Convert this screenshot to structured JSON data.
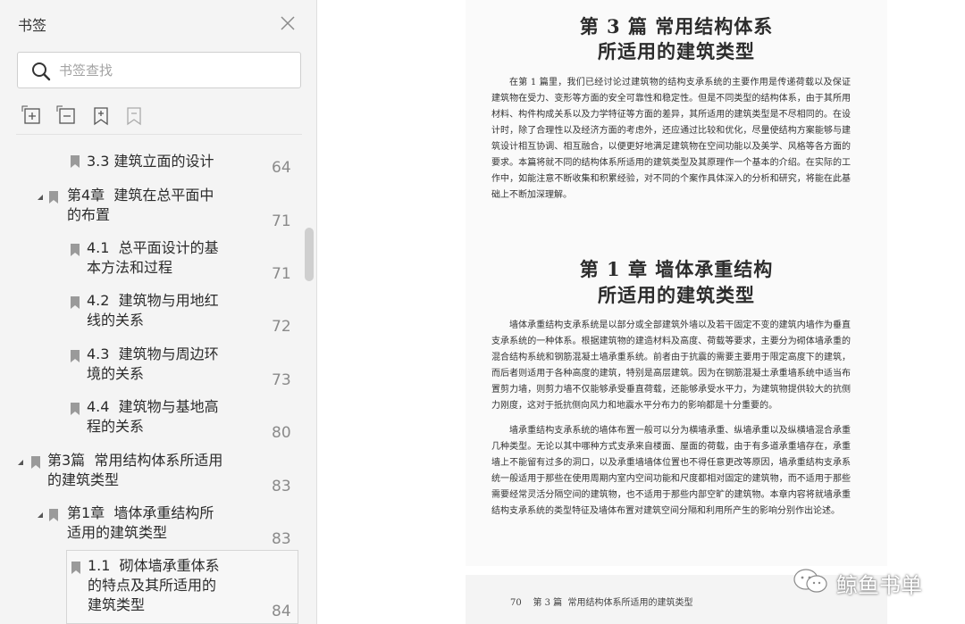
{
  "sidebar": {
    "title": "书签",
    "search_placeholder": "书签查找",
    "bookmarks": [
      {
        "label": "3.3  建筑立面的设计",
        "page": "64"
      },
      {
        "label": "第4章  建筑在总平面中\n的布置",
        "page": "71"
      },
      {
        "label": "4.1  总平面设计的基\n本方法和过程",
        "page": "71"
      },
      {
        "label": "4.2  建筑物与用地红\n线的关系",
        "page": "72"
      },
      {
        "label": "4.3  建筑物与周边环\n境的关系",
        "page": "73"
      },
      {
        "label": "4.4  建筑物与基地高\n程的关系",
        "page": "80"
      },
      {
        "label": "第3篇  常用结构体系所适用\n的建筑类型",
        "page": "83"
      },
      {
        "label": "第1章  墙体承重结构所\n适用的建筑类型",
        "page": "83"
      },
      {
        "label": "1.1  砌体墙承重体系\n的特点及其所适用的\n建筑类型",
        "page": "84"
      }
    ]
  },
  "document": {
    "part_title_1": "第 3 篇   常用结构体系",
    "part_title_2": "所适用的建筑类型",
    "intro": "在第 1 篇里，我们已经讨论过建筑物的结构支承系统的主要作用是传递荷载以及保证建筑物在受力、变形等方面的安全可靠性和稳定性。但是不同类型的结构体系，由于其所用材料、构件构成关系以及力学特征等方面的差异，其所适用的建筑类型是不尽相同的。在设计时，除了合理性以及经济方面的考虑外，还应通过比较和优化，尽量使结构方案能够与建筑设计相互协调、相互融合，以便更好地满足建筑物在空间功能以及美学、风格等各方面的要求。本篇将就不同的结构体系所适用的建筑类型及其原理作一个基本的介绍。在实际的工作中，如能注意不断收集和积累经验，对不同的个案作具体深入的分析和研究，将能在此基础上不断加深理解。",
    "chapter_title_1": "第 1 章   墙体承重结构",
    "chapter_title_2": "所适用的建筑类型",
    "para1": "墙体承重结构支承系统是以部分或全部建筑外墙以及若干固定不变的建筑内墙作为垂直支承系统的一种体系。根据建筑物的建造材料及高度、荷载等要求，主要分为砌体墙承重的混合结构系统和钢筋混凝土墙承重系统。前者由于抗震的需要主要用于限定高度下的建筑，而后者则适用于各种高度的建筑，特别是高层建筑。因为在钢筋混凝土承重墙系统中适当布置剪力墙，则剪力墙不仅能够承受垂直荷载，还能够承受水平力，为建筑物提供较大的抗侧力刚度，这对于抵抗侧向风力和地震水平分布力的影响都是十分重要的。",
    "para2": "墙承重结构支承系统的墙体布置一般可以分为横墙承重、纵墙承重以及纵横墙混合承重几种类型。无论以其中哪种方式支承来自楼面、屋面的荷载，由于有多道承重墙存在，承重墙上不能留有过多的洞口，以及承重墙墙体位置也不得任意更改等原因，墙承重结构支承系统一般适用于那些在使用周期内室内空间功能和尺度都相对固定的建筑物，而不适用于那些需要经常灵活分隔空间的建筑物，也不适用于那些内部空旷的建筑物。本章内容将就墙承重结构支承系统的类型特征及墙体布置对建筑空间分隔和利用所产生的影响分别作出论述。",
    "footer": "70    第 3 篇  常用结构体系所适用的建筑类型"
  },
  "watermark": {
    "text": "鲸鱼书单"
  },
  "icons": {
    "close": "close-icon",
    "search": "search-icon",
    "expand_all": "expand-all-icon",
    "collapse_all": "collapse-all-icon",
    "add_bookmark": "add-bookmark-icon",
    "remove_bookmark": "remove-bookmark-icon",
    "bookmark": "bookmark-icon",
    "expanded_arrow": "expanded-arrow-icon",
    "wechat": "wechat-icon"
  }
}
